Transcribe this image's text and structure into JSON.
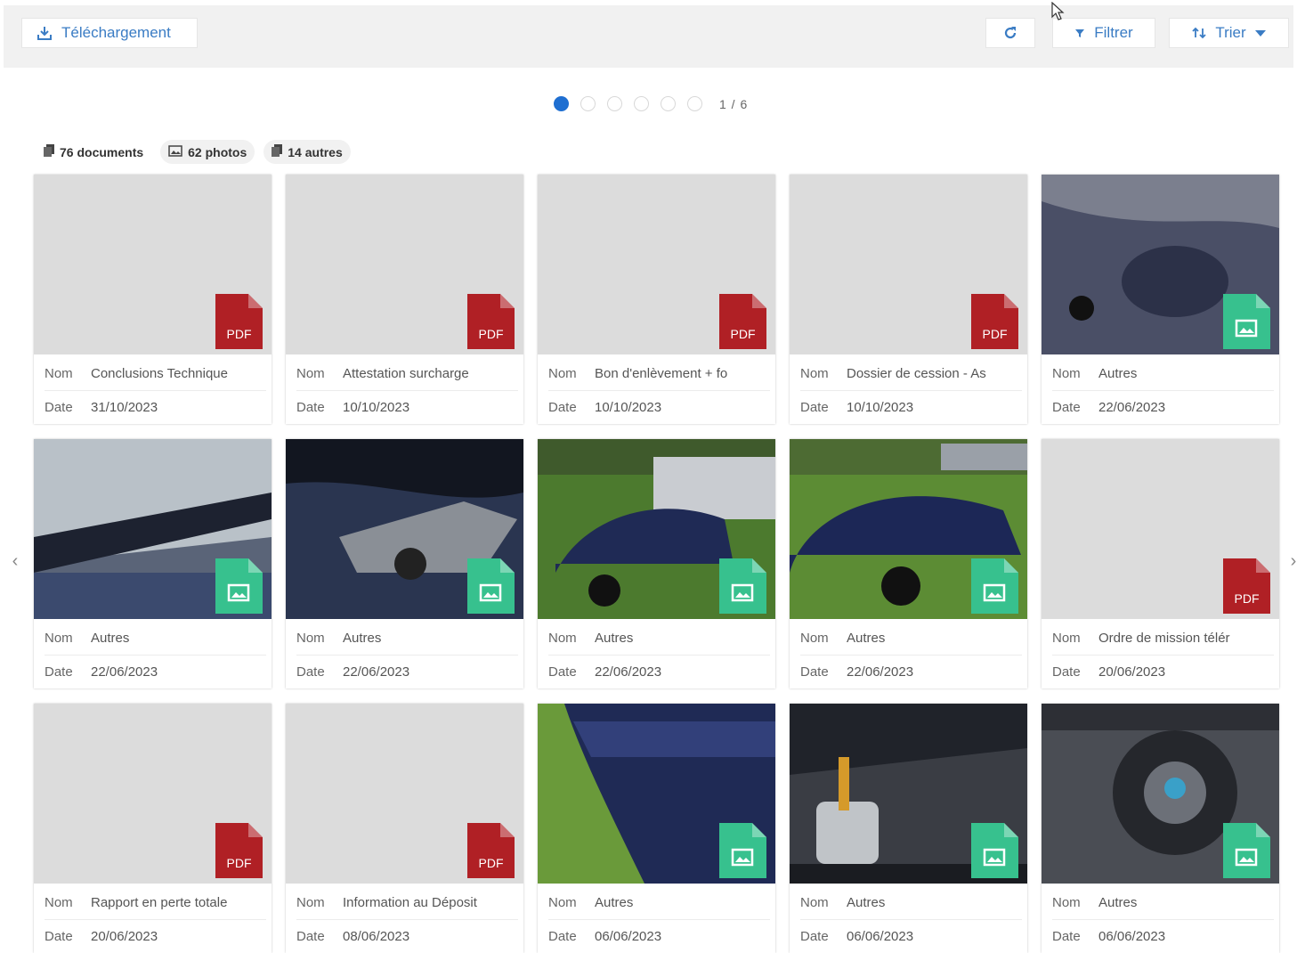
{
  "toolbar": {
    "upload_label": "Téléchargement",
    "filter_label": "Filtrer",
    "sort_label": "Trier"
  },
  "pager": {
    "page_count": "1 / 6",
    "total_pages": 6,
    "current_page": 1
  },
  "stats": {
    "documents": "76 documents",
    "photos": "62 photos",
    "others": "14 autres"
  },
  "labels": {
    "name": "Nom",
    "date": "Date"
  },
  "badges": {
    "pdf": "PDF"
  },
  "colors": {
    "pdf": "#b02025",
    "image": "#37c18e",
    "accent": "#3a7cc4",
    "active_dot": "#1f6fd1"
  },
  "cards": [
    {
      "type": "pdf",
      "name": "Conclusions Technique",
      "date": "31/10/2023"
    },
    {
      "type": "pdf",
      "name": "Attestation surcharge",
      "date": "10/10/2023"
    },
    {
      "type": "pdf",
      "name": "Bon d'enlèvement + fo",
      "date": "10/10/2023"
    },
    {
      "type": "pdf",
      "name": "Dossier de cession - As",
      "date": "10/10/2023"
    },
    {
      "type": "image",
      "name": "Autres",
      "date": "22/06/2023"
    },
    {
      "type": "image",
      "name": "Autres",
      "date": "22/06/2023"
    },
    {
      "type": "image",
      "name": "Autres",
      "date": "22/06/2023"
    },
    {
      "type": "image",
      "name": "Autres",
      "date": "22/06/2023"
    },
    {
      "type": "image",
      "name": "Autres",
      "date": "22/06/2023"
    },
    {
      "type": "pdf",
      "name": "Ordre de mission télér",
      "date": "20/06/2023"
    },
    {
      "type": "pdf",
      "name": "Rapport en perte totale",
      "date": "20/06/2023"
    },
    {
      "type": "pdf",
      "name": "Information au Déposit",
      "date": "08/06/2023"
    },
    {
      "type": "image",
      "name": "Autres",
      "date": "06/06/2023"
    },
    {
      "type": "image",
      "name": "Autres",
      "date": "06/06/2023"
    },
    {
      "type": "image",
      "name": "Autres",
      "date": "06/06/2023"
    }
  ]
}
